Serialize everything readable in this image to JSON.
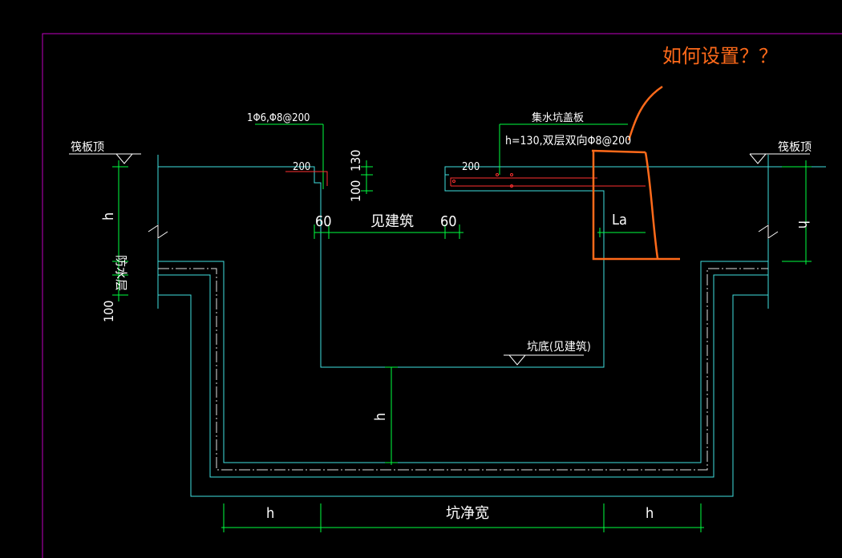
{
  "colors": {
    "background": "#000000",
    "frame": "#c000c0",
    "outline": "#40e0e0",
    "dimension": "#00ff40",
    "white": "#ffffff",
    "red": "#ff3030",
    "annotation": "#ff6a1a"
  },
  "labels": {
    "raft_top_left": "筏板顶",
    "raft_top_right": "筏板顶",
    "waterproof_layer": "防水层",
    "rebar_left": "1Φ6,Φ8@200",
    "cover_title": "集水坑盖板",
    "cover_spec": "h=130,双层双向Φ8@200",
    "pit_bottom": "坑底(见建筑)",
    "see_arch": "见建筑",
    "net_width": "坑净宽",
    "question": "如何设置？？"
  },
  "dims": {
    "h_left": "h",
    "h_right": "h",
    "h_center": "h",
    "h_bottom_left": "h",
    "h_bottom_right": "h",
    "d100_left": "100",
    "d130": "130",
    "d100_top": "100",
    "d60_left": "60",
    "d60_right": "60",
    "d200_left": "200",
    "d200_right": "200",
    "la": "La"
  }
}
